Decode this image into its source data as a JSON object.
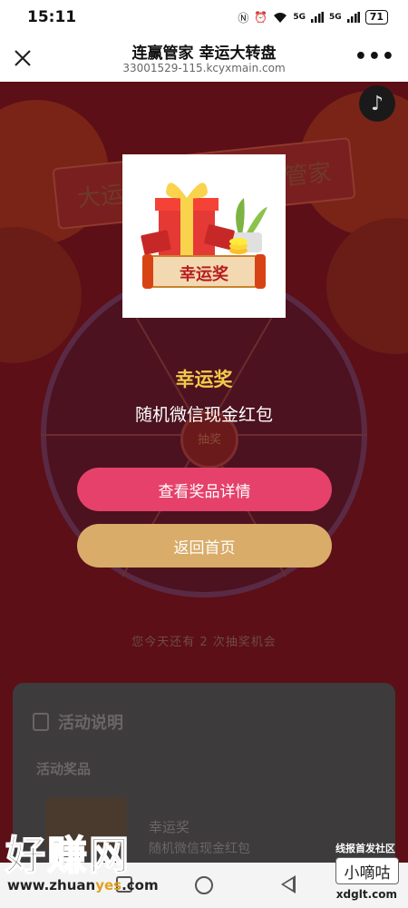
{
  "status_bar": {
    "time": "15:11",
    "signal_1": "5G",
    "signal_2": "5G",
    "battery": "71"
  },
  "header": {
    "title": "连赢管家 幸运大转盘",
    "url": "33001529-115.kcyxmain.com",
    "more_label": "•••"
  },
  "background": {
    "banner_left": "大运",
    "banner_right": "管家",
    "wheel_center_label": "抽奖",
    "chances_text": "您今天还有 2 次抽奖机会",
    "rules_title": "活动说明",
    "rules_subtitle": "活动奖品",
    "rules_prize_name": "幸运奖",
    "rules_prize_desc": "随机微信现金红包"
  },
  "modal": {
    "image_label": "幸运奖",
    "prize_title": "幸运奖",
    "prize_subtitle": "随机微信现金红包",
    "details_button": "查看奖品详情",
    "home_button": "返回首页"
  },
  "watermark": {
    "left_text": "好赚网",
    "left_url_prefix": "www.zhuan",
    "left_url_highlight": "yes",
    "left_url_suffix": ".com",
    "right_top": "线报首发社区",
    "right_box": "小嘀咕",
    "right_bottom": "xdglt.com"
  },
  "colors": {
    "details_button": "#e6416a",
    "home_button": "#d9ac6a",
    "prize_title": "#f3c94a"
  }
}
